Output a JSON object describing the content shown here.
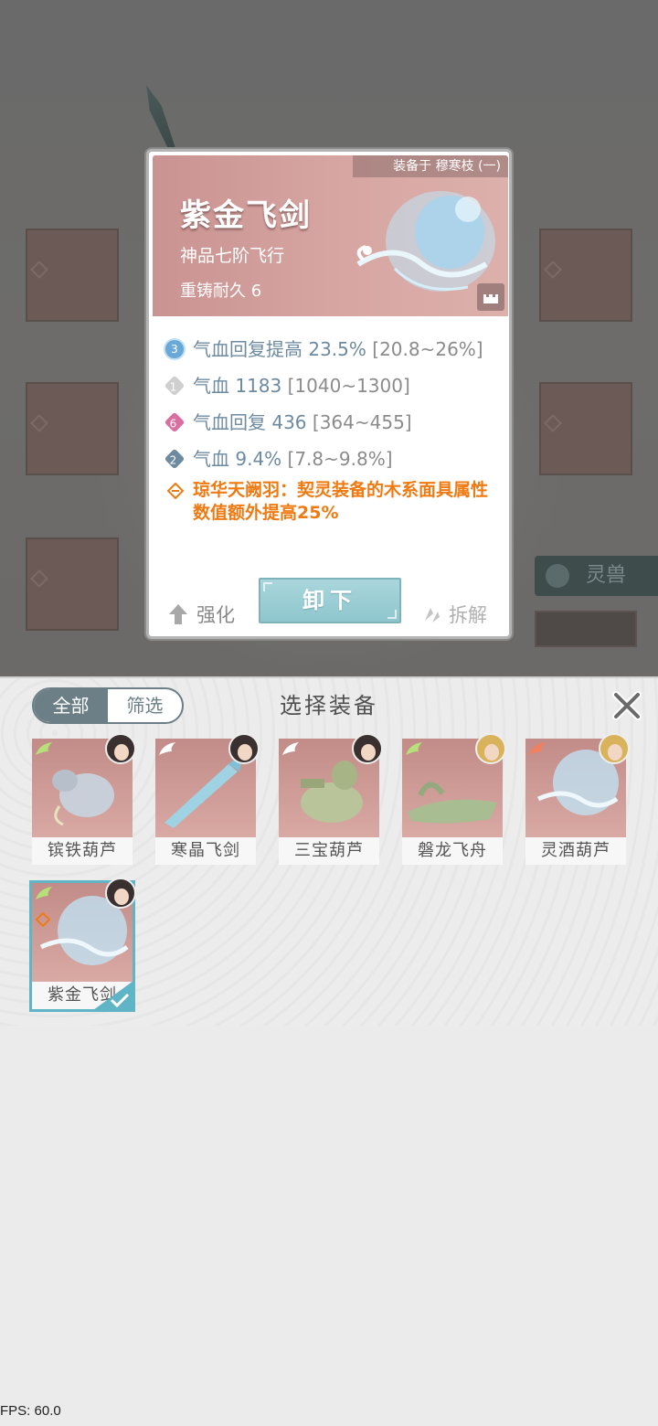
{
  "popup": {
    "equipped_by": "装备于 穆寒枝 (一)",
    "item_name": "紫金飞剑",
    "grade": "神品七阶飞行",
    "durability": "重铸耐久 6",
    "attributes": [
      {
        "badge": "3",
        "text": "气血回复提高 23.5%",
        "range": "[20.8~26%]"
      },
      {
        "badge": "1",
        "text": "气血 1183",
        "range": "[1040~1300]"
      },
      {
        "badge": "6",
        "text": "气血回复 436",
        "range": "[364~455]"
      },
      {
        "badge": "2",
        "text": "气血 9.4%",
        "range": "[7.8~9.8%]"
      }
    ],
    "set_bonus": "琼华天阙羽：契灵装备的木系面具属性数值额外提高25%",
    "enhance_label": "强化",
    "unequip_label": "卸下",
    "dismantle_label": "拆解"
  },
  "background": {
    "spirit_tab_label": "灵兽"
  },
  "panel": {
    "filters": [
      "全部",
      "筛选"
    ],
    "title": "选择装备",
    "items": [
      {
        "name": "镔铁葫芦",
        "wing_color": "#b6e07a"
      },
      {
        "name": "寒晶飞剑",
        "wing_color": "#ffffff"
      },
      {
        "name": "三宝葫芦",
        "wing_color": "#ffffff"
      },
      {
        "name": "磐龙飞舟",
        "wing_color": "#b6e07a"
      },
      {
        "name": "灵酒葫芦",
        "wing_color": "#f08060"
      },
      {
        "name": "紫金飞剑",
        "wing_color": "#b6e07a",
        "selected": true
      }
    ]
  },
  "fps": "FPS: 60.0",
  "colors": {
    "accent_teal": "#5fb4c6",
    "set_orange": "#f07a12",
    "attr_blue": "#6d8aa0"
  }
}
